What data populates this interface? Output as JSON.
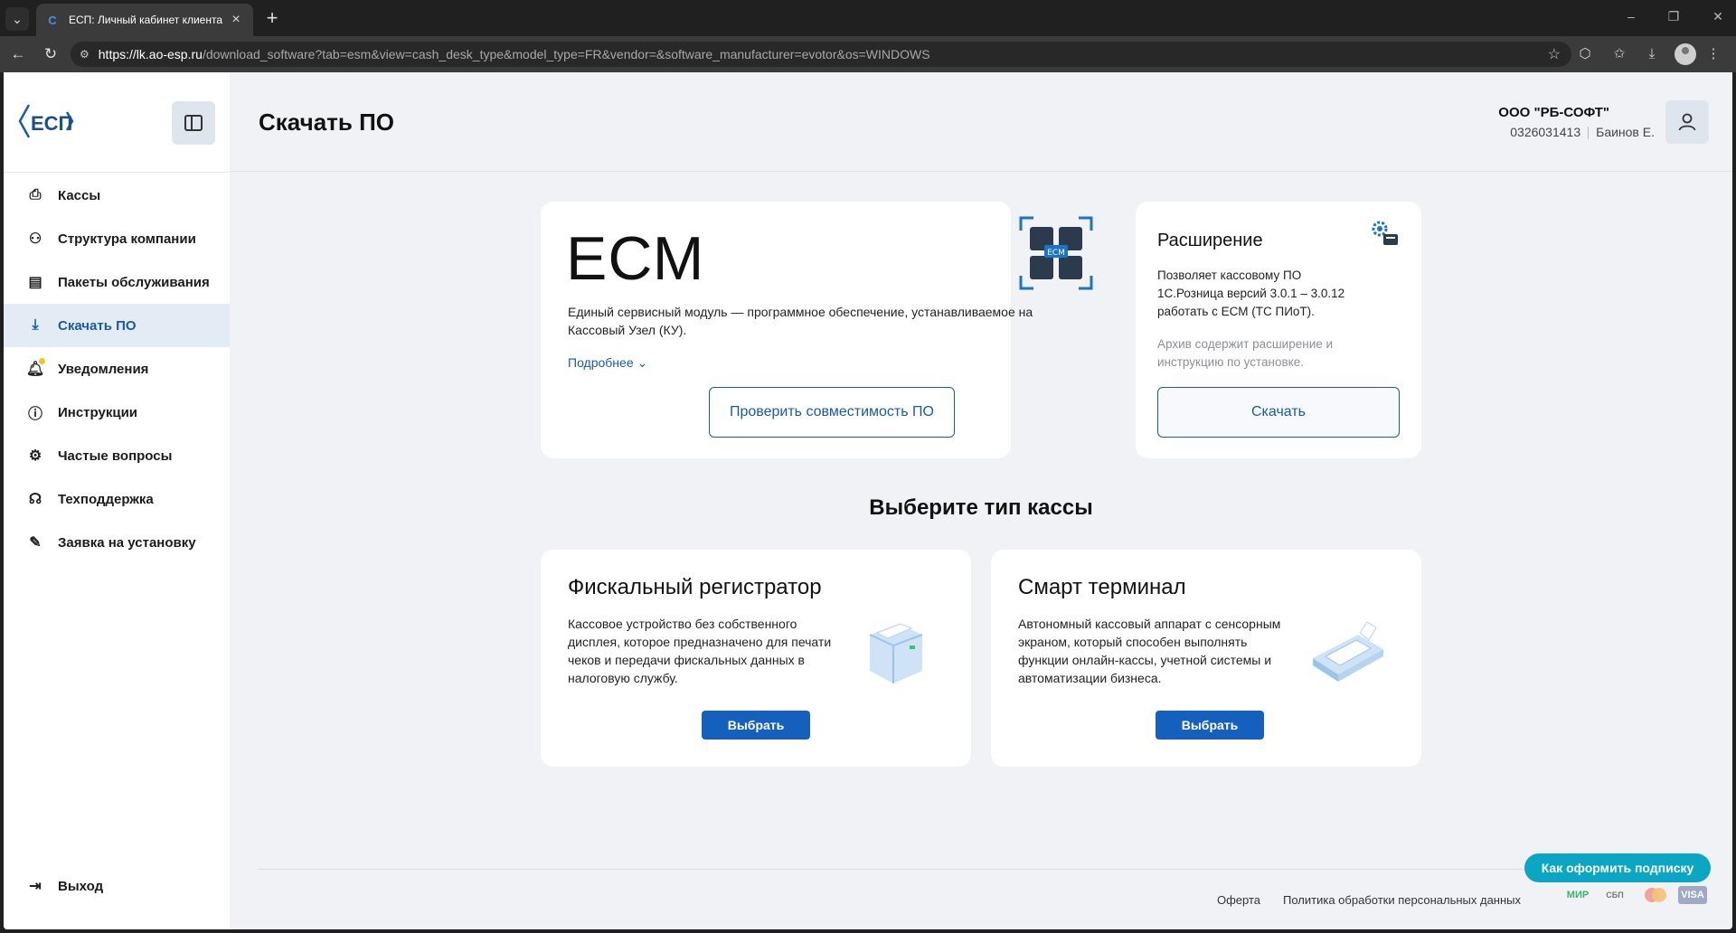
{
  "browser": {
    "tab_title": "ЕСП: Личный кабинет клиента",
    "url_host": "https://lk.ao-esp.ru",
    "url_rest": "/download_software?tab=esm&view=cash_desk_type&model_type=FR&vendor=&software_manufacturer=evotor&os=WINDOWS"
  },
  "sidebar": {
    "logo_text": "ЕСП",
    "items": [
      {
        "label": "Кассы",
        "icon": "cash-register-icon"
      },
      {
        "label": "Структура компании",
        "icon": "hierarchy-icon"
      },
      {
        "label": "Пакеты обслуживания",
        "icon": "package-icon"
      },
      {
        "label": "Скачать ПО",
        "icon": "download-icon",
        "active": true
      },
      {
        "label": "Уведомления",
        "icon": "bell-icon"
      },
      {
        "label": "Инструкции",
        "icon": "info-icon"
      },
      {
        "label": "Частые вопросы",
        "icon": "faq-icon"
      },
      {
        "label": "Техподдержка",
        "icon": "headset-icon"
      },
      {
        "label": "Заявка на установку",
        "icon": "request-icon"
      }
    ],
    "logout_label": "Выход"
  },
  "header": {
    "title": "Скачать ПО",
    "org_name": "ООО \"РБ-СОФТ\"",
    "inn": "0326031413",
    "user": "Баинов Е."
  },
  "ecm_card": {
    "title": "ЕСМ",
    "description": "Единый сервисный модуль — программное обеспечение, устанавливаемое на Кассовый Узел (КУ).",
    "more_label": "Подробнее",
    "check_button": "Проверить совместимость ПО",
    "badge_text": "ECM"
  },
  "extension_card": {
    "title": "Расширение",
    "description": "Позволяет кассовому ПО 1С.Розница версий 3.0.1 – 3.0.12 работать с ЕСМ (ТС ПИоТ).",
    "note": "Архив содержит расширение и инструкцию по установке.",
    "download_button": "Скачать"
  },
  "section_title": "Выберите тип кассы",
  "cash_types": [
    {
      "title": "Фискальный регистратор",
      "description": "Кассовое устройство без собственного дисплея, которое предназначено для печати чеков и передачи фискальных данных в налоговую службу.",
      "button": "Выбрать"
    },
    {
      "title": "Смарт терминал",
      "description": "Автономный кассовый аппарат с сенсорным экраном, который способен выполнять функции онлайн-кассы, учетной системы и автоматизации бизнеса.",
      "button": "Выбрать"
    }
  ],
  "footer": {
    "offer": "Оферта",
    "privacy": "Политика обработки персональных данных",
    "payments": [
      "МИР",
      "СБП",
      "Mastercard",
      "VISA"
    ],
    "help_button": "Как оформить подписку"
  },
  "colors": {
    "accent": "#1a5aa8",
    "primary_button": "#1560bd",
    "help_button": "#0aa6c4",
    "page_bg": "#f0f2f5"
  }
}
